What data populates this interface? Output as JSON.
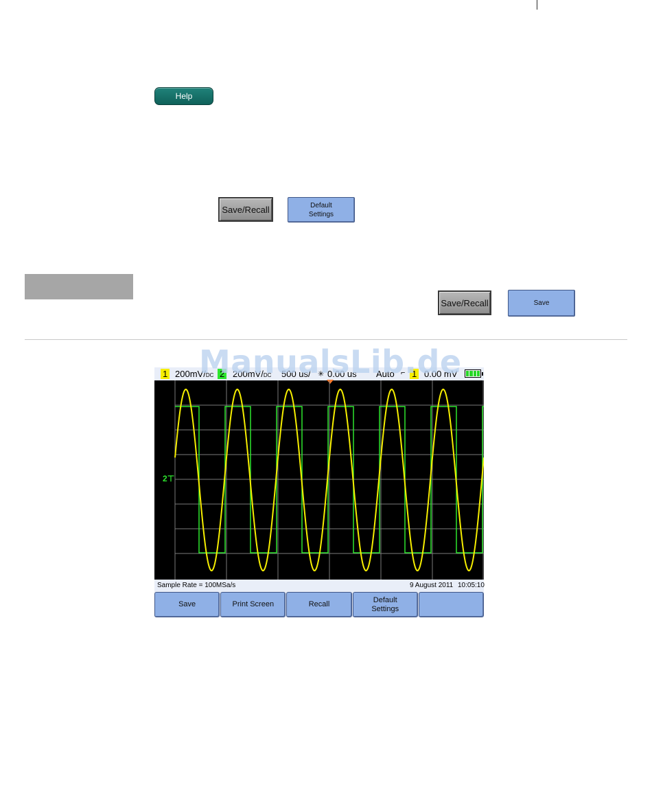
{
  "top_help_button": "Help",
  "example1": {
    "key": "Save/Recall",
    "softkey": [
      "Default",
      "Settings"
    ]
  },
  "example2": {
    "key": "Save/Recall",
    "softkey": "Save"
  },
  "watermark": "ManualsLib.de",
  "scope": {
    "status": {
      "ch1_label": "1",
      "ch1_scale": "200mV/",
      "ch1_coupling": "DC",
      "ch2_label": "2",
      "ch2_scale": "200mV/",
      "ch2_coupling": "DC",
      "timebase": "500 us/",
      "trigger_delay": "0.00 us",
      "trigger_mode": "Auto",
      "trigger_source": "1",
      "trigger_level": "0.00 mV"
    },
    "ground_marker": "2",
    "info": {
      "sample_rate": "Sample Rate = 100MSa/s",
      "date": "9 August 2011",
      "time": "10:05:10"
    },
    "softkeys": [
      {
        "line1": "Save",
        "line2": ""
      },
      {
        "line1": "Print Screen",
        "line2": ""
      },
      {
        "line1": "Recall",
        "line2": ""
      },
      {
        "line1": "Default",
        "line2": "Settings"
      },
      {
        "line1": "",
        "line2": ""
      }
    ],
    "colors": {
      "ch1": "#f6ee00",
      "ch2": "#2ee62e",
      "grid": "#7a7a7a",
      "background": "#000000"
    },
    "waveforms": {
      "ch1": {
        "shape": "sine",
        "cycles_on_screen": 6
      },
      "ch2": {
        "shape": "square",
        "cycles_on_screen": 6
      }
    }
  }
}
